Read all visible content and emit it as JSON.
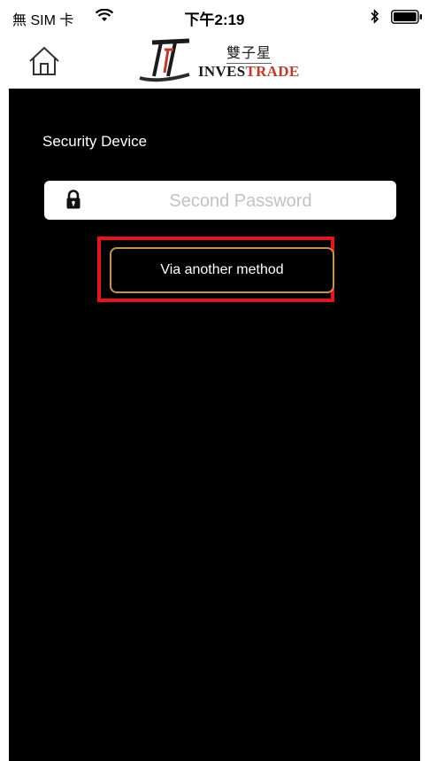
{
  "status_bar": {
    "carrier": "無 SIM 卡",
    "time": "下午2:19",
    "icons": [
      "wifi-icon",
      "bluetooth-icon",
      "battery-icon"
    ]
  },
  "header": {
    "home_icon": "home-icon",
    "logo_cn": "雙子星",
    "logo_en_part1": "INVES",
    "logo_en_part2": "TRADE"
  },
  "main": {
    "section_title": "Security Device",
    "password_placeholder": "Second Password",
    "lock_icon": "lock-icon",
    "method_button_label": "Via another method"
  },
  "colors": {
    "background": "#000000",
    "button_border": "#c8914a",
    "highlight": "#e8141b",
    "logo_accent": "#c0392b"
  }
}
